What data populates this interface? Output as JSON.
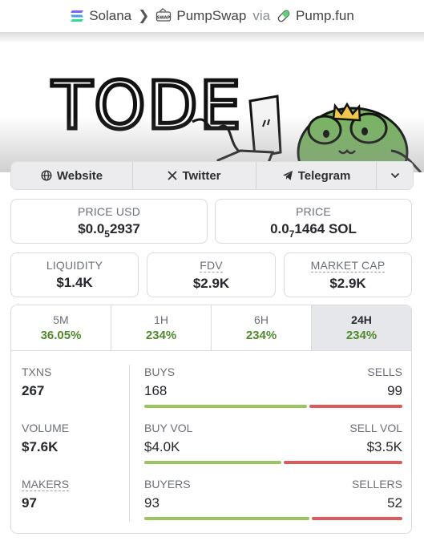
{
  "breadcrumb": {
    "chain": "Solana",
    "dex": "PumpSwap",
    "via": "via",
    "launchpad": "Pump.fun",
    "dex_icon_text": "SWAP"
  },
  "banner": {
    "logo_text": "TODE"
  },
  "links": {
    "website": "Website",
    "twitter": "Twitter",
    "telegram": "Telegram",
    "more_icon": "chevron-down-icon"
  },
  "price": {
    "usd_label": "PRICE USD",
    "usd_prefix": "$0.0",
    "usd_sub": "5",
    "usd_rest": "2937",
    "native_label": "PRICE",
    "native_prefix": "0.0",
    "native_sub": "7",
    "native_rest": "1464 SOL"
  },
  "metrics": {
    "liquidity_label": "LIQUIDITY",
    "liquidity_value": "$1.4K",
    "fdv_label": "FDV",
    "fdv_value": "$2.9K",
    "mcap_label": "MARKET CAP",
    "mcap_value": "$2.9K"
  },
  "timeframes": [
    {
      "label": "5M",
      "value": "36.05%"
    },
    {
      "label": "1H",
      "value": "234%"
    },
    {
      "label": "6H",
      "value": "234%"
    },
    {
      "label": "24H",
      "value": "234%"
    }
  ],
  "active_timeframe": "24H",
  "stats": {
    "txns_label": "TXNS",
    "txns_value": "267",
    "volume_label": "VOLUME",
    "volume_value": "$7.6K",
    "makers_label": "MAKERS",
    "makers_value": "97",
    "buys_label": "BUYS",
    "buys_value": "168",
    "sells_label": "SELLS",
    "sells_value": "99",
    "buys_share": 0.63,
    "buyvol_label": "BUY VOL",
    "buyvol_value": "$4.0K",
    "sellvol_label": "SELL VOL",
    "sellvol_value": "$3.5K",
    "buyvol_share": 0.53,
    "buyers_label": "BUYERS",
    "buyers_value": "93",
    "sellers_label": "SELLERS",
    "sellers_value": "52",
    "buyers_share": 0.64
  },
  "colors": {
    "positive": "#4f8a2c",
    "buy_bar": "#9bc55e",
    "sell_bar": "#de5a5a"
  }
}
